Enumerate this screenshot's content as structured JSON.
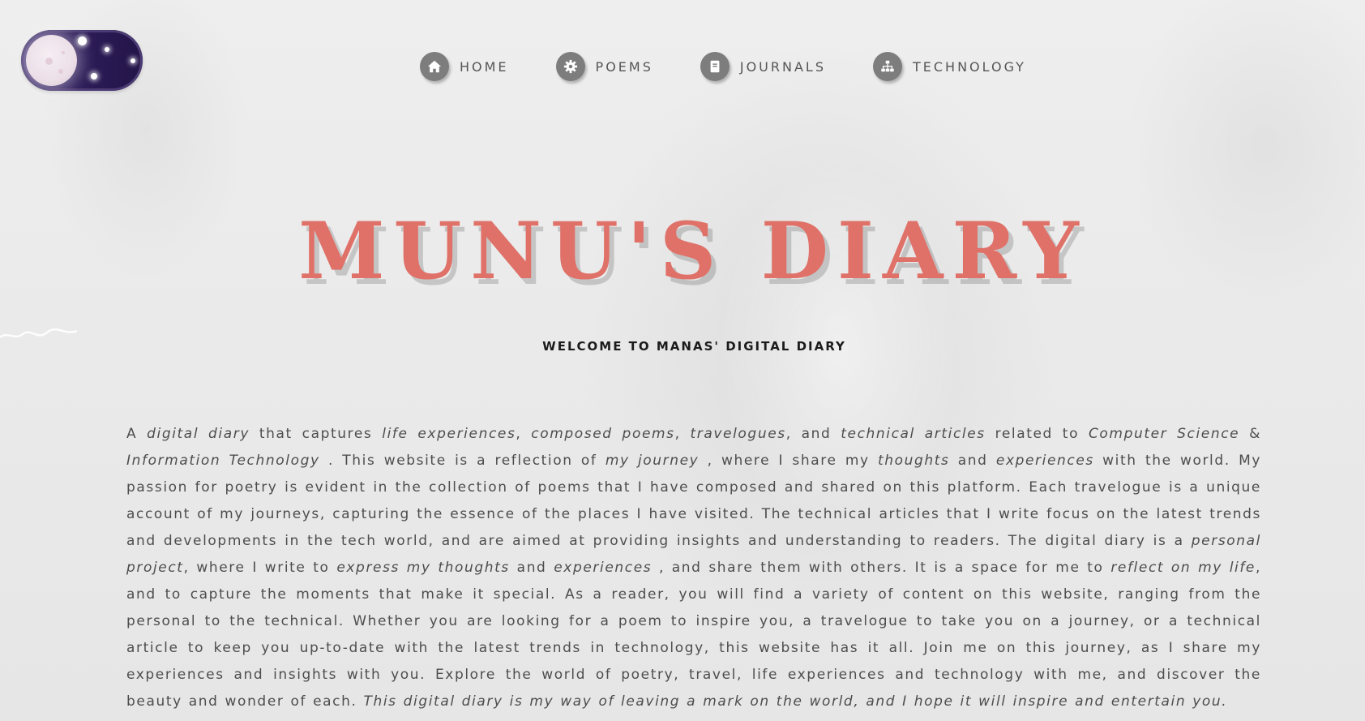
{
  "theme_toggle": {
    "state": "dark",
    "icon": "moon-icon"
  },
  "nav": {
    "items": [
      {
        "label": "HOME",
        "icon": "home-icon"
      },
      {
        "label": "POEMS",
        "icon": "gear-icon"
      },
      {
        "label": "JOURNALS",
        "icon": "book-icon"
      },
      {
        "label": "TECHNOLOGY",
        "icon": "sitemap-icon"
      }
    ]
  },
  "hero": {
    "title": "MUNU'S DIARY",
    "subtitle": "WELCOME TO MANAS' DIGITAL DIARY"
  },
  "intro": {
    "p01": "A ",
    "p02": "digital diary",
    "p03": " that captures ",
    "p04": "life experiences",
    "p05": ", ",
    "p06": "composed poems",
    "p07": ", ",
    "p08": "travelogues",
    "p09": ", and ",
    "p10": "technical articles",
    "p11": " related to ",
    "p12": "Computer Science",
    "p13": " & ",
    "p14": "Information Technology",
    "p15": " . This website is a reflection of ",
    "p16": "my journey",
    "p17": " , where I share my ",
    "p18": "thoughts",
    "p19": " and ",
    "p20": "experiences",
    "p21": " with the world. My passion for poetry is evident in the collection of poems that I have composed and shared on this platform. Each travelogue is a unique account of my journeys, capturing the essence of the places I have visited. The technical articles that I write focus on the latest trends and developments in the tech world, and are aimed at providing insights and understanding to readers. The digital diary is a ",
    "p22": "personal project",
    "p23": ", where I write to ",
    "p24": "express my thoughts",
    "p25": " and ",
    "p26": "experiences",
    "p27": " , and share them with others. It is a space for me to ",
    "p28": "reflect on my life",
    "p29": ", and to capture the moments that make it special. As a reader, you will find a variety of content on this website, ranging from the personal to the technical. Whether you are looking for a poem to inspire you, a travelogue to take you on a journey, or a technical article to keep you up-to-date with the latest trends in technology, this website has it all. Join me on this journey, as I share my experiences and insights with you. Explore the world of poetry, travel, life experiences and technology with me, and discover the beauty and wonder of each. ",
    "p30": "This digital diary is my way of leaving a mark on the world, and I hope it will inspire and entertain you."
  },
  "colors": {
    "title": "#df7168",
    "nav_icon_bg": "#7d7d7d",
    "toggle_bg": "#2e1d5a",
    "text": "#4d4d4d"
  }
}
